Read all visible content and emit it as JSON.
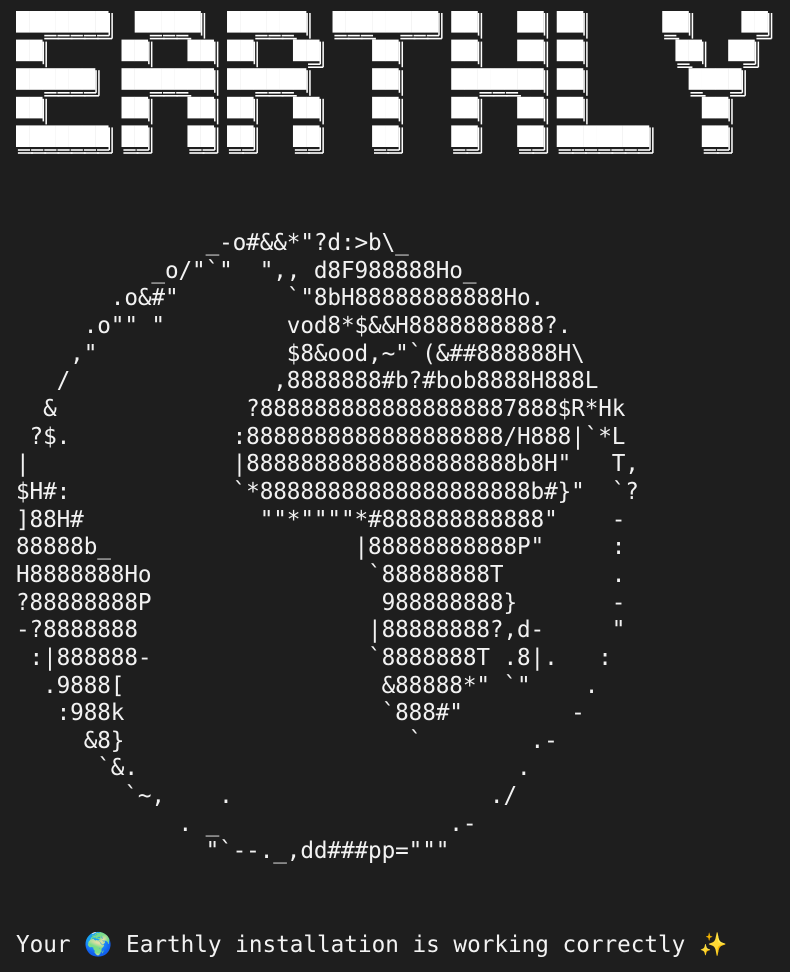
{
  "terminal": {
    "background": "#1e1e1e",
    "foreground": "#ffffff",
    "banner": {
      "text": "EARTHLY",
      "style": "double-line box-drawing block letters"
    },
    "globe_art": "              _-o#&&*\"?d:>b\\_\n          _o/\"`\"  \",, d8F988888Ho_\n       .o&#\"        `\"8bH88888888888Ho.\n     .o\"\" \"         vod8*$&&H8888888888?.\n    ,\"              $8&ood,~\"`(&##888888H\\\n   /               ,8888888#b?#bob8888H888L\n  &              ?8888888888888888887888$R*Hk\n ?$.            :8888888888888888888/H888|`*L\n|               |88888888888888888888b8H\"   T,\n$H#:            `*88888888888888888888b#}\"  `?\n]88H#             \"\"*\"\"\"\"*#888888888888\"    -\n88888b_                  |88888888888P\"     :\nH8888888Ho                `88888888T        .\n?88888888P                 988888888}       -\n-?8888888                 |88888888?,d-     \"\n :|888888-                `8888888T .8|.   :\n  .9888[                   &88888*\" `\"    .\n   :988k                   `888#\"        -\n     &8}                     `        .-\n      `&.                            .\n        `~,    .                   ./\n            . _                 .-\n              \"`--._,dd###pp=\"\"\"",
    "status": {
      "prefix": "Your ",
      "globe_emoji": "🌍",
      "message": " Earthly installation is working correctly ",
      "sparkle_emoji": "✨"
    }
  }
}
